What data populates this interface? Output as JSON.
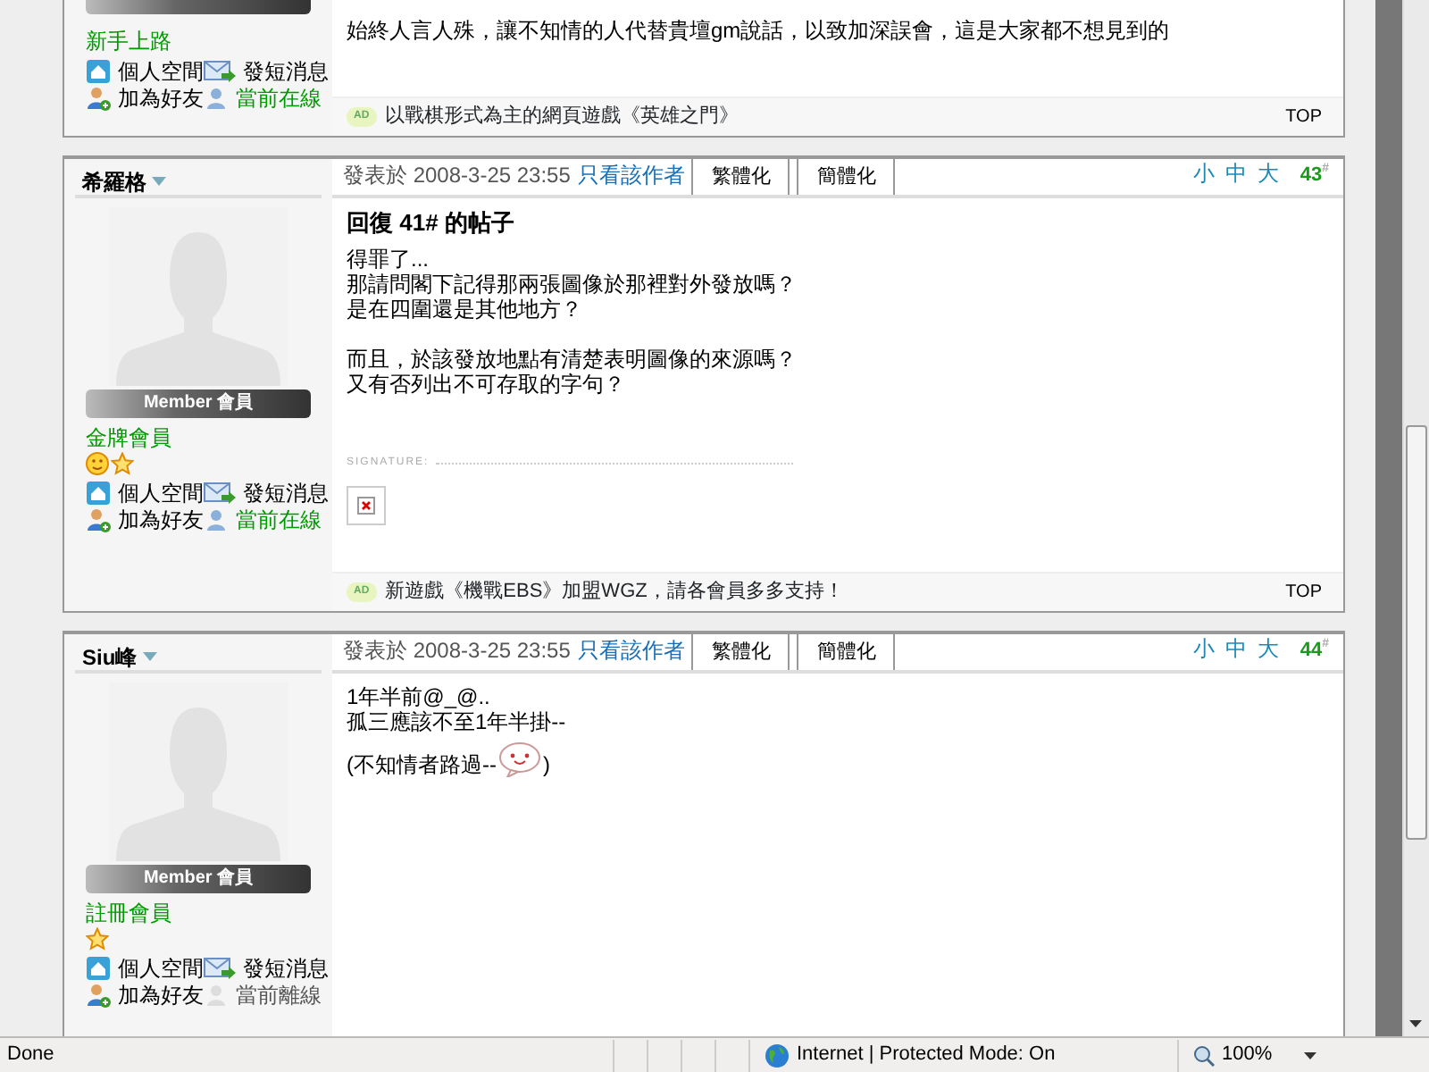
{
  "posts": [
    {
      "member_bar": {
        "cut": true
      },
      "rank": "新手上路",
      "links": [
        {
          "kind": "home",
          "label": "個人空間"
        },
        {
          "kind": "message",
          "label": "發短消息"
        },
        {
          "kind": "friend",
          "label": "加為好友"
        },
        {
          "kind": "status",
          "label": "當前在線",
          "online": true
        }
      ],
      "lines": [
        "始終人言人殊，讓不知情的人代替貴壇gm說話，以致加深誤會，這是大家都不想見到的"
      ],
      "ad": {
        "badge": "AD",
        "text": "以戰棋形式為主的網頁遊戲《英雄之門》"
      },
      "top": "TOP"
    },
    {
      "author": "希羅格",
      "avatar": true,
      "member_bar": {
        "label": "Member 會員"
      },
      "rank": "金牌會員",
      "rank_icons": [
        {
          "kind": "smiley"
        },
        {
          "kind": "star"
        }
      ],
      "links": [
        {
          "kind": "home",
          "label": "個人空間"
        },
        {
          "kind": "message",
          "label": "發短消息"
        },
        {
          "kind": "friend",
          "label": "加為好友"
        },
        {
          "kind": "status",
          "label": "當前在線",
          "online": true
        }
      ],
      "posted": "發表於 2008-3-25 23:55",
      "author_only": "只看該作者",
      "tabs": [
        "繁體化",
        "簡體化"
      ],
      "sizes": [
        "小",
        "中",
        "大"
      ],
      "floor": "43",
      "floor_mark": "#",
      "title": "回復 41# 的帖子",
      "lines": [
        "得罪了...",
        "那請問閣下記得那兩張圖像於那裡對外發放嗎？",
        "是在四圍還是其他地方？",
        {
          "text": "而且，於該發放地點有清楚表明圖像的來源嗎？",
          "spaced": true
        },
        "又有否列出不可存取的字句？"
      ],
      "signature": {
        "label": "SIGNATURE:",
        "broken_image": true
      },
      "ad": {
        "badge": "AD",
        "text": "新遊戲《機戰EBS》加盟WGZ，請各會員多多支持！"
      },
      "top": "TOP"
    },
    {
      "author": "Siu峰",
      "avatar": true,
      "member_bar": {
        "label": "Member 會員"
      },
      "rank": "註冊會員",
      "rank_icons": [
        {
          "kind": "star"
        }
      ],
      "links": [
        {
          "kind": "home",
          "label": "個人空間"
        },
        {
          "kind": "message",
          "label": "發短消息"
        },
        {
          "kind": "friend",
          "label": "加為好友"
        },
        {
          "kind": "status",
          "label": "當前離線",
          "online": false
        }
      ],
      "posted": "發表於 2008-3-25 23:55",
      "author_only": "只看該作者",
      "tabs": [
        "繁體化",
        "簡體化"
      ],
      "sizes": [
        "小",
        "中",
        "大"
      ],
      "floor": "44",
      "floor_mark": "#",
      "lines": [
        "1年半前@_@..",
        "孤三應該不至1年半掛--",
        {
          "text": "(不知情者路過--",
          "emoticon": true,
          "after": ")"
        }
      ]
    }
  ],
  "status_bar": {
    "left": "Done",
    "zone": "Internet | Protected Mode: On",
    "zoom": "100%"
  }
}
